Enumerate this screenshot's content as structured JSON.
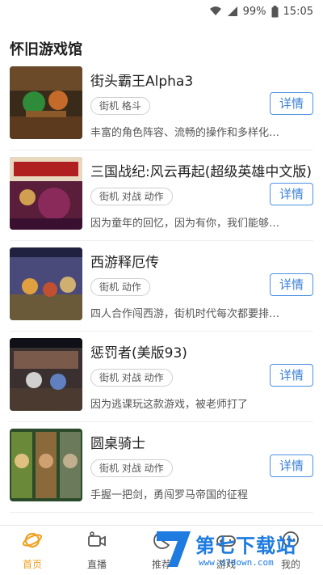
{
  "status_bar": {
    "battery_percent": "99%",
    "time": "15:05",
    "icons": [
      "wifi-icon",
      "signal-icon",
      "battery-icon"
    ]
  },
  "page": {
    "title": "怀旧游戏馆"
  },
  "games": [
    {
      "name": "街头霸王Alpha3",
      "tags": "街机 格斗",
      "detail_label": "详情",
      "description": "丰富的角色阵容、流畅的操作和多样化…"
    },
    {
      "name": "三国战纪:风云再起(超级英雄中文版)",
      "tags": "街机 对战 动作",
      "detail_label": "详情",
      "description": "因为童年的回忆，因为有你，我们能够…"
    },
    {
      "name": "西游释厄传",
      "tags": "街机 动作",
      "detail_label": "详情",
      "description": "四人合作闯西游，街机时代每次都要排…"
    },
    {
      "name": "惩罚者(美版93)",
      "tags": "街机 对战 动作",
      "detail_label": "详情",
      "description": "因为逃课玩这款游戏，被老师打了"
    },
    {
      "name": "圆桌骑士",
      "tags": "街机 对战 动作",
      "detail_label": "详情",
      "description": "手握一把剑，勇闯罗马帝国的征程"
    }
  ],
  "tabbar": {
    "items": [
      {
        "label": "首页",
        "icon": "planet-icon",
        "active": true
      },
      {
        "label": "直播",
        "icon": "video-camera-icon",
        "active": false
      },
      {
        "label": "推荐",
        "icon": "pacman-icon",
        "active": false
      },
      {
        "label": "游戏",
        "icon": "gamepad-icon",
        "active": false
      },
      {
        "label": "我的",
        "icon": "chat-icon",
        "active": false
      }
    ]
  },
  "watermark": {
    "text": "第七下载站",
    "url": "www.d7down.com"
  },
  "colors": {
    "accent": "#f0a020",
    "button_blue": "#3a7fd5",
    "watermark_blue": "#1e7be0"
  }
}
